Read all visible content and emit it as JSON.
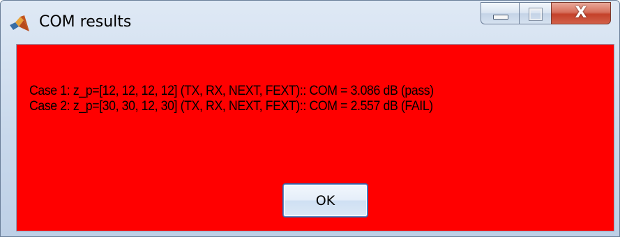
{
  "window": {
    "title": "COM results",
    "app_icon": "matlab-icon",
    "caption_buttons": {
      "minimize_icon": "minimize-icon",
      "maximize_icon": "maximize-icon",
      "close_icon": "close-icon",
      "close_glyph": "X"
    },
    "background_color": "#ff0000"
  },
  "message": {
    "lines": [
      "Case 1: z_p=[12, 12, 12, 12] (TX, RX, NEXT, FEXT):: COM = 3.086 dB (pass)",
      "Case 2: z_p=[30, 30, 12, 30] (TX, RX, NEXT, FEXT):: COM = 2.557 dB (FAIL)"
    ]
  },
  "buttons": {
    "ok_label": "OK"
  }
}
